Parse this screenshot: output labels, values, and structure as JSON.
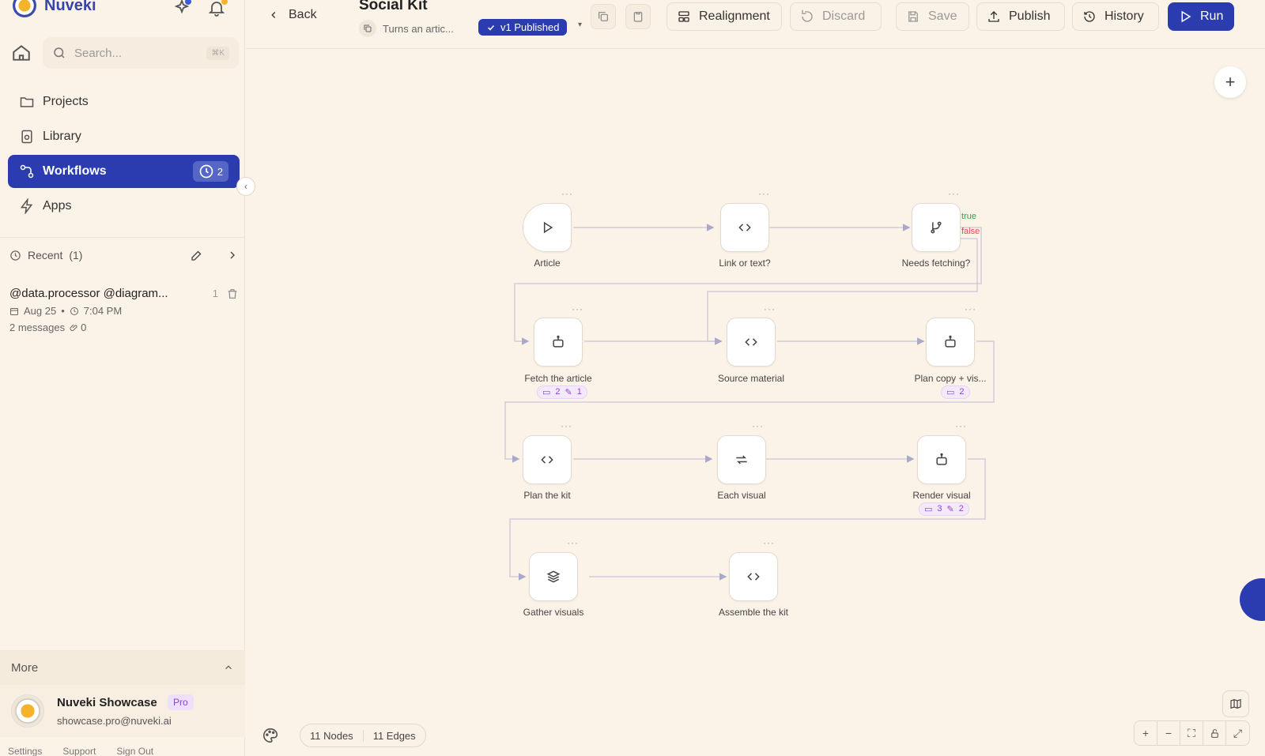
{
  "brand": {
    "name": "Nuveki"
  },
  "search": {
    "placeholder": "Search...",
    "shortcut": "⌘K"
  },
  "nav": {
    "items": [
      {
        "label": "Projects"
      },
      {
        "label": "Library"
      },
      {
        "label": "Workflows",
        "badge": "2"
      },
      {
        "label": "Apps"
      }
    ]
  },
  "recent": {
    "label": "Recent",
    "count": "(1)",
    "item": {
      "title": "@data.processor @diagram...",
      "num": "1",
      "date": "Aug 25",
      "time": "7:04 PM",
      "messages": "2 messages",
      "attachments": "0"
    }
  },
  "more": {
    "label": "More"
  },
  "profile": {
    "name": "Nuveki Showcase",
    "badge": "Pro",
    "email": "showcase.pro@nuveki.ai"
  },
  "footer": {
    "settings": "Settings",
    "support": "Support",
    "signout": "Sign Out"
  },
  "topbar": {
    "back": "Back",
    "title": "Social Kit",
    "subtitle": "Turns an artic...",
    "version": "v1 Published",
    "realignment": "Realignment",
    "discard": "Discard",
    "save": "Save",
    "publish": "Publish",
    "history": "History",
    "run": "Run"
  },
  "workflow": {
    "nodes": [
      {
        "label": "Article"
      },
      {
        "label": "Link or text?"
      },
      {
        "label": "Needs fetching?",
        "true_label": "true",
        "false_label": "false"
      },
      {
        "label": "Fetch the article",
        "comments": "2",
        "edits": "1"
      },
      {
        "label": "Source material"
      },
      {
        "label": "Plan copy + vis...",
        "comments": "2"
      },
      {
        "label": "Plan the kit"
      },
      {
        "label": "Each visual"
      },
      {
        "label": "Render visual",
        "comments": "3",
        "edits": "2"
      },
      {
        "label": "Gather visuals"
      },
      {
        "label": "Assemble the kit"
      }
    ],
    "node_count": "11 Nodes",
    "edge_count": "11 Edges"
  },
  "colors": {
    "accent": "#2a3cb0",
    "background": "#fcf3e8",
    "true": "#2da44e",
    "false": "#e5484d",
    "chip": "#8a46c8"
  }
}
